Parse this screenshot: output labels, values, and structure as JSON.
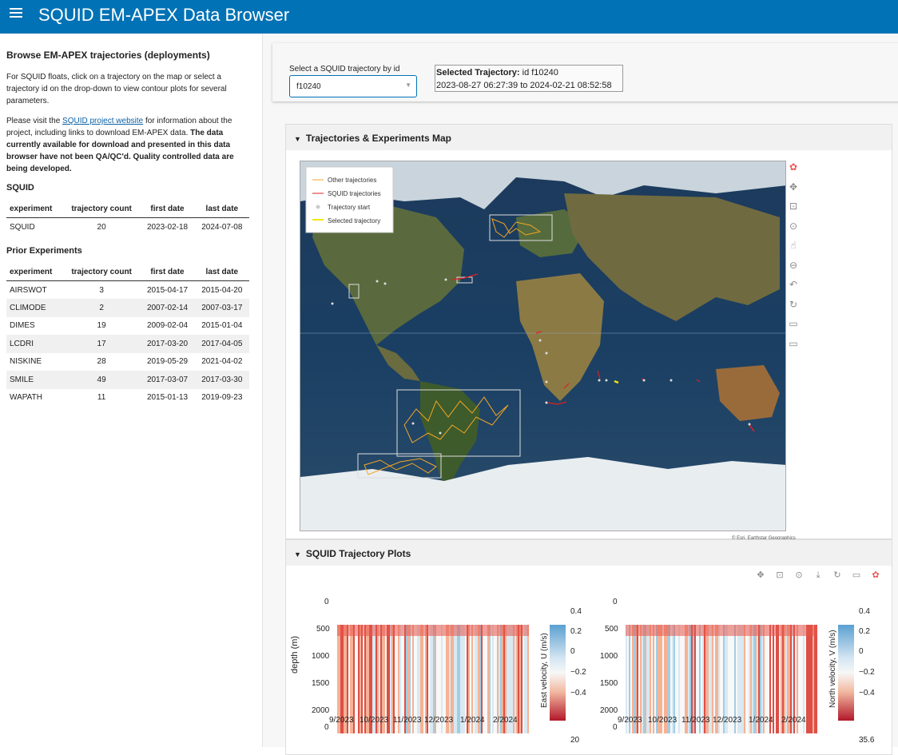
{
  "header": {
    "title": "SQUID EM-APEX Data Browser",
    "menu_icon": "hamburger-icon"
  },
  "sidebar": {
    "heading": "Browse EM-APEX trajectories (deployments)",
    "intro": "For SQUID floats, click on a trajectory on the map or select a trajectory id on the drop-down to view contour plots for several parameters.",
    "visit_prefix": "Please visit the ",
    "visit_link": "SQUID project website",
    "visit_suffix": " for information about the project, including links to download EM-APEX data. ",
    "visit_bold": "The data currently available for download and presented in this data browser have not been QA/QC'd. Quality controlled data are being developed.",
    "squid_heading": "SQUID",
    "prior_heading": "Prior Experiments",
    "columns": [
      "experiment",
      "trajectory count",
      "first date",
      "last date"
    ],
    "squid_rows": [
      [
        "SQUID",
        "20",
        "2023-02-18",
        "2024-07-08"
      ]
    ],
    "prior_rows": [
      [
        "AIRSWOT",
        "3",
        "2015-04-17",
        "2015-04-20"
      ],
      [
        "CLIMODE",
        "2",
        "2007-02-14",
        "2007-03-17"
      ],
      [
        "DIMES",
        "19",
        "2009-02-04",
        "2015-01-04"
      ],
      [
        "LCDRI",
        "17",
        "2017-03-20",
        "2017-04-05"
      ],
      [
        "NISKINE",
        "28",
        "2019-05-29",
        "2021-04-02"
      ],
      [
        "SMILE",
        "49",
        "2017-03-07",
        "2017-03-30"
      ],
      [
        "WAPATH",
        "11",
        "2015-01-13",
        "2019-09-23"
      ]
    ]
  },
  "selector": {
    "label": "Select a SQUID trajectory by id",
    "value": "f10240",
    "selected_label": "Selected Trajectory:",
    "selected_id": " id f10240",
    "selected_range": "2023-08-27 06:27:39 to 2024-02-21 08:52:58"
  },
  "map_card": {
    "title": "Trajectories & Experiments Map",
    "legend": [
      "Other trajectories",
      "SQUID trajectories",
      "Trajectory start",
      "Selected trajectory"
    ],
    "legend_colors": [
      "#f5a623",
      "#e02020",
      "#cccccc",
      "#f5e60a"
    ],
    "attribution": "© Esri, Earthstar Geographics",
    "tools": [
      "bokeh-logo-icon",
      "pan-icon",
      "box-zoom-icon",
      "wheel-zoom-icon",
      "tap-icon",
      "zoom-out-icon",
      "undo-icon",
      "reset-icon",
      "hover-icon",
      "hover-icon"
    ]
  },
  "plots_card": {
    "title": "SQUID Trajectory Plots",
    "tools": [
      "pan-icon",
      "box-zoom-icon",
      "wheel-zoom-icon",
      "save-icon",
      "reset-icon",
      "hover-icon",
      "bokeh-logo-icon"
    ],
    "depth_label": "depth (m)",
    "depth_ticks": [
      "0",
      "500",
      "1000",
      "1500",
      "2000"
    ],
    "time_ticks": [
      "9/2023",
      "10/2023",
      "11/2023",
      "12/2023",
      "1/2024",
      "2/2024"
    ],
    "u_colorbar_label": "East velocity, U (m/s)",
    "v_colorbar_label": "North velocity, V (m/s)",
    "velocity_ticks": [
      "0.4",
      "0.2",
      "0",
      "−0.2",
      "−0.4"
    ],
    "lower_depth_tick": "0",
    "lower_left_cbar_tick": "20",
    "lower_right_cbar_tick": "35.6"
  }
}
